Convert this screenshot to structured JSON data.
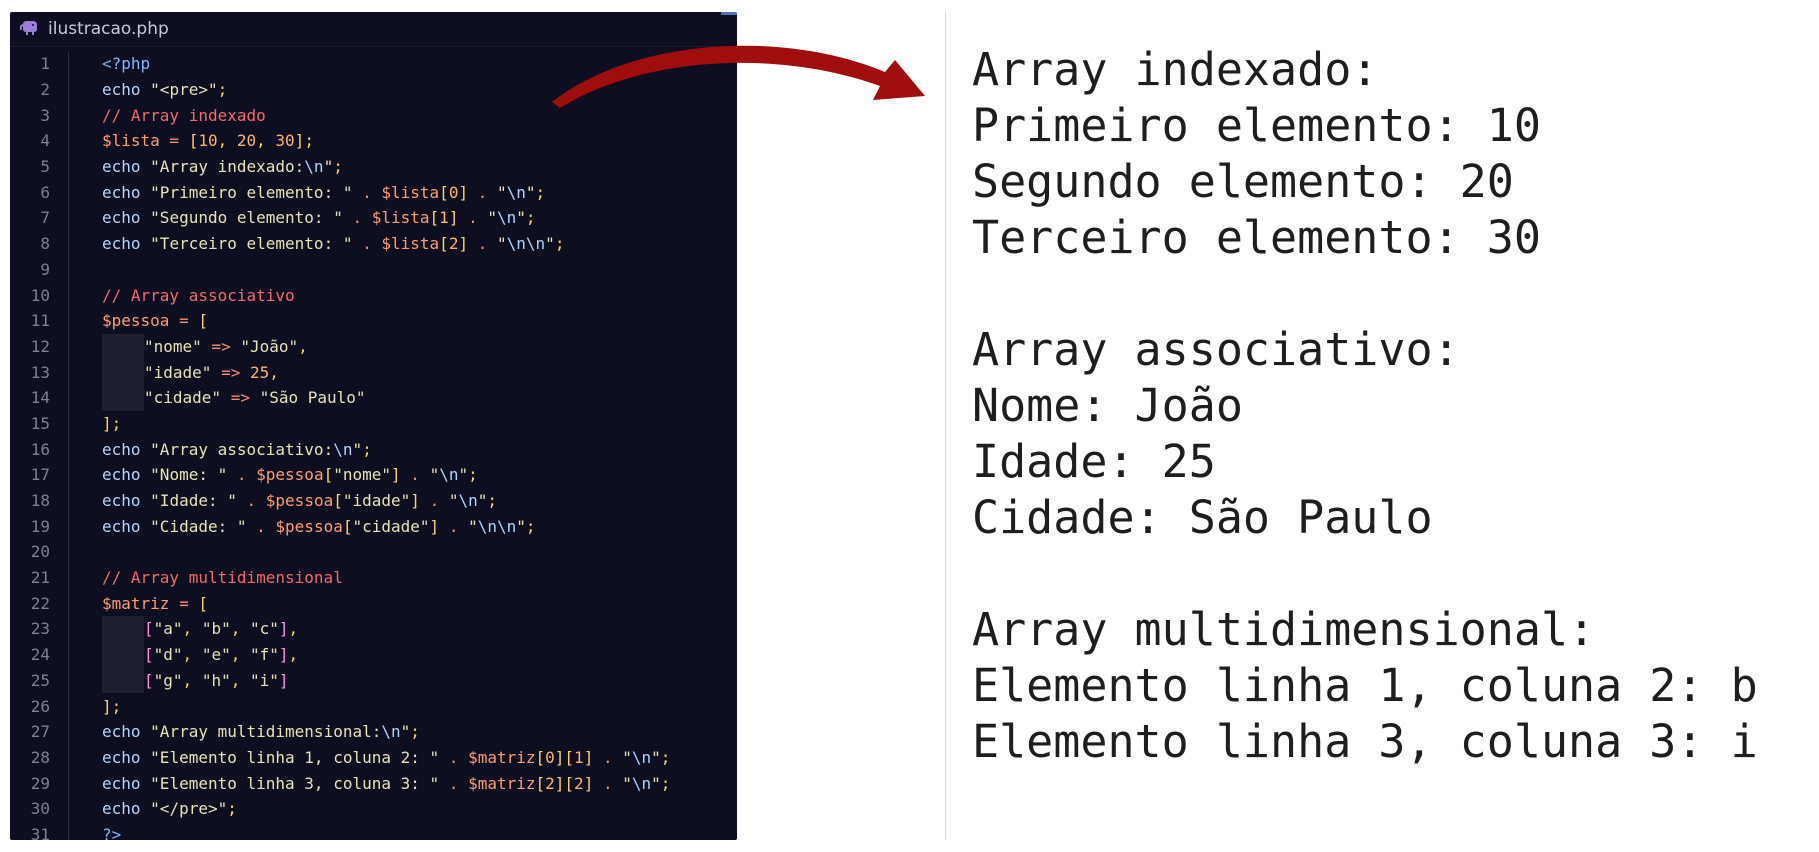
{
  "editor": {
    "filename": "ilustracao.php",
    "icon": "php-elephant-icon",
    "lines": [
      {
        "n": "1",
        "tokens": [
          [
            "kw",
            "<?php"
          ]
        ]
      },
      {
        "n": "2",
        "tokens": [
          [
            "fn",
            "echo "
          ],
          [
            "str",
            "\"<pre>\""
          ],
          [
            "punc",
            ";"
          ]
        ]
      },
      {
        "n": "3",
        "tokens": [
          [
            "com",
            "// Array indexado"
          ]
        ]
      },
      {
        "n": "4",
        "tokens": [
          [
            "var",
            "$lista"
          ],
          [
            "op",
            " = "
          ],
          [
            "punc",
            "["
          ],
          [
            "num",
            "10"
          ],
          [
            "punc",
            ", "
          ],
          [
            "num",
            "20"
          ],
          [
            "punc",
            ", "
          ],
          [
            "num",
            "30"
          ],
          [
            "punc",
            "]"
          ],
          [
            "punc",
            ";"
          ]
        ]
      },
      {
        "n": "5",
        "tokens": [
          [
            "fn",
            "echo "
          ],
          [
            "str",
            "\"Array indexado:"
          ],
          [
            "esc",
            "\\n"
          ],
          [
            "str",
            "\""
          ],
          [
            "punc",
            ";"
          ]
        ]
      },
      {
        "n": "6",
        "tokens": [
          [
            "fn",
            "echo "
          ],
          [
            "str",
            "\"Primeiro elemento: \""
          ],
          [
            "op",
            " . "
          ],
          [
            "var",
            "$lista"
          ],
          [
            "punc",
            "["
          ],
          [
            "num",
            "0"
          ],
          [
            "punc",
            "]"
          ],
          [
            "op",
            " . "
          ],
          [
            "str",
            "\""
          ],
          [
            "esc",
            "\\n"
          ],
          [
            "str",
            "\""
          ],
          [
            "punc",
            ";"
          ]
        ]
      },
      {
        "n": "7",
        "tokens": [
          [
            "fn",
            "echo "
          ],
          [
            "str",
            "\"Segundo elemento: \""
          ],
          [
            "op",
            " . "
          ],
          [
            "var",
            "$lista"
          ],
          [
            "punc",
            "["
          ],
          [
            "num",
            "1"
          ],
          [
            "punc",
            "]"
          ],
          [
            "op",
            " . "
          ],
          [
            "str",
            "\""
          ],
          [
            "esc",
            "\\n"
          ],
          [
            "str",
            "\""
          ],
          [
            "punc",
            ";"
          ]
        ]
      },
      {
        "n": "8",
        "tokens": [
          [
            "fn",
            "echo "
          ],
          [
            "str",
            "\"Terceiro elemento: \""
          ],
          [
            "op",
            " . "
          ],
          [
            "var",
            "$lista"
          ],
          [
            "punc",
            "["
          ],
          [
            "num",
            "2"
          ],
          [
            "punc",
            "]"
          ],
          [
            "op",
            " . "
          ],
          [
            "str",
            "\""
          ],
          [
            "esc",
            "\\n\\n"
          ],
          [
            "str",
            "\""
          ],
          [
            "punc",
            ";"
          ]
        ]
      },
      {
        "n": "9",
        "tokens": []
      },
      {
        "n": "10",
        "tokens": [
          [
            "com",
            "// Array associativo"
          ]
        ]
      },
      {
        "n": "11",
        "tokens": [
          [
            "var",
            "$pessoa"
          ],
          [
            "op",
            " = "
          ],
          [
            "punc",
            "["
          ]
        ]
      },
      {
        "n": "12",
        "indent": true,
        "tokens": [
          [
            "str",
            "\"nome\""
          ],
          [
            "op",
            " => "
          ],
          [
            "str",
            "\"João\""
          ],
          [
            "punc",
            ","
          ]
        ]
      },
      {
        "n": "13",
        "indent": true,
        "tokens": [
          [
            "str",
            "\"idade\""
          ],
          [
            "op",
            " => "
          ],
          [
            "num",
            "25"
          ],
          [
            "punc",
            ","
          ]
        ]
      },
      {
        "n": "14",
        "indent": true,
        "tokens": [
          [
            "str",
            "\"cidade\""
          ],
          [
            "op",
            " => "
          ],
          [
            "str",
            "\"São Paulo\""
          ]
        ]
      },
      {
        "n": "15",
        "tokens": [
          [
            "punc",
            "];"
          ]
        ]
      },
      {
        "n": "16",
        "tokens": [
          [
            "fn",
            "echo "
          ],
          [
            "str",
            "\"Array associativo:"
          ],
          [
            "esc",
            "\\n"
          ],
          [
            "str",
            "\""
          ],
          [
            "punc",
            ";"
          ]
        ]
      },
      {
        "n": "17",
        "tokens": [
          [
            "fn",
            "echo "
          ],
          [
            "str",
            "\"Nome: \""
          ],
          [
            "op",
            " . "
          ],
          [
            "var",
            "$pessoa"
          ],
          [
            "punc",
            "["
          ],
          [
            "str",
            "\"nome\""
          ],
          [
            "punc",
            "]"
          ],
          [
            "op",
            " . "
          ],
          [
            "str",
            "\""
          ],
          [
            "esc",
            "\\n"
          ],
          [
            "str",
            "\""
          ],
          [
            "punc",
            ";"
          ]
        ]
      },
      {
        "n": "18",
        "tokens": [
          [
            "fn",
            "echo "
          ],
          [
            "str",
            "\"Idade: \""
          ],
          [
            "op",
            " . "
          ],
          [
            "var",
            "$pessoa"
          ],
          [
            "punc",
            "["
          ],
          [
            "str",
            "\"idade\""
          ],
          [
            "punc",
            "]"
          ],
          [
            "op",
            " . "
          ],
          [
            "str",
            "\""
          ],
          [
            "esc",
            "\\n"
          ],
          [
            "str",
            "\""
          ],
          [
            "punc",
            ";"
          ]
        ]
      },
      {
        "n": "19",
        "tokens": [
          [
            "fn",
            "echo "
          ],
          [
            "str",
            "\"Cidade: \""
          ],
          [
            "op",
            " . "
          ],
          [
            "var",
            "$pessoa"
          ],
          [
            "punc",
            "["
          ],
          [
            "str",
            "\"cidade\""
          ],
          [
            "punc",
            "]"
          ],
          [
            "op",
            " . "
          ],
          [
            "str",
            "\""
          ],
          [
            "esc",
            "\\n\\n"
          ],
          [
            "str",
            "\""
          ],
          [
            "punc",
            ";"
          ]
        ]
      },
      {
        "n": "20",
        "tokens": []
      },
      {
        "n": "21",
        "tokens": [
          [
            "com",
            "// Array multidimensional"
          ]
        ]
      },
      {
        "n": "22",
        "tokens": [
          [
            "var",
            "$matriz"
          ],
          [
            "op",
            " = "
          ],
          [
            "punc",
            "["
          ]
        ]
      },
      {
        "n": "23",
        "indent": true,
        "tokens": [
          [
            "arr",
            "["
          ],
          [
            "str",
            "\"a\""
          ],
          [
            "punc",
            ", "
          ],
          [
            "str",
            "\"b\""
          ],
          [
            "punc",
            ", "
          ],
          [
            "str",
            "\"c\""
          ],
          [
            "arr",
            "]"
          ],
          [
            "punc",
            ","
          ]
        ]
      },
      {
        "n": "24",
        "indent": true,
        "tokens": [
          [
            "arr",
            "["
          ],
          [
            "str",
            "\"d\""
          ],
          [
            "punc",
            ", "
          ],
          [
            "str",
            "\"e\""
          ],
          [
            "punc",
            ", "
          ],
          [
            "str",
            "\"f\""
          ],
          [
            "arr",
            "]"
          ],
          [
            "punc",
            ","
          ]
        ]
      },
      {
        "n": "25",
        "indent": true,
        "tokens": [
          [
            "arr",
            "["
          ],
          [
            "str",
            "\"g\""
          ],
          [
            "punc",
            ", "
          ],
          [
            "str",
            "\"h\""
          ],
          [
            "punc",
            ", "
          ],
          [
            "str",
            "\"i\""
          ],
          [
            "arr",
            "]"
          ]
        ]
      },
      {
        "n": "26",
        "tokens": [
          [
            "punc",
            "];"
          ]
        ]
      },
      {
        "n": "27",
        "tokens": [
          [
            "fn",
            "echo "
          ],
          [
            "str",
            "\"Array multidimensional:"
          ],
          [
            "esc",
            "\\n"
          ],
          [
            "str",
            "\""
          ],
          [
            "punc",
            ";"
          ]
        ]
      },
      {
        "n": "28",
        "tokens": [
          [
            "fn",
            "echo "
          ],
          [
            "str",
            "\"Elemento linha 1, coluna 2: \""
          ],
          [
            "op",
            " . "
          ],
          [
            "var",
            "$matriz"
          ],
          [
            "punc",
            "["
          ],
          [
            "num",
            "0"
          ],
          [
            "punc",
            "]["
          ],
          [
            "num",
            "1"
          ],
          [
            "punc",
            "]"
          ],
          [
            "op",
            " . "
          ],
          [
            "str",
            "\""
          ],
          [
            "esc",
            "\\n"
          ],
          [
            "str",
            "\""
          ],
          [
            "punc",
            ";"
          ]
        ]
      },
      {
        "n": "29",
        "tokens": [
          [
            "fn",
            "echo "
          ],
          [
            "str",
            "\"Elemento linha 3, coluna 3: \""
          ],
          [
            "op",
            " . "
          ],
          [
            "var",
            "$matriz"
          ],
          [
            "punc",
            "["
          ],
          [
            "num",
            "2"
          ],
          [
            "punc",
            "]["
          ],
          [
            "num",
            "2"
          ],
          [
            "punc",
            "]"
          ],
          [
            "op",
            " . "
          ],
          [
            "str",
            "\""
          ],
          [
            "esc",
            "\\n"
          ],
          [
            "str",
            "\""
          ],
          [
            "punc",
            ";"
          ]
        ]
      },
      {
        "n": "30",
        "tokens": [
          [
            "fn",
            "echo "
          ],
          [
            "str",
            "\"</pre>\""
          ],
          [
            "punc",
            ";"
          ]
        ]
      },
      {
        "n": "31",
        "tokens": [
          [
            "kw",
            "?>"
          ]
        ]
      }
    ]
  },
  "arrow": {
    "icon": "curved-arrow-icon",
    "color": "#a00d0d"
  },
  "output": {
    "lines": [
      "Array indexado:",
      "Primeiro elemento: 10",
      "Segundo elemento: 20",
      "Terceiro elemento: 30",
      "",
      "Array associativo:",
      "Nome: João",
      "Idade: 25",
      "Cidade: São Paulo",
      "",
      "Array multidimensional:",
      "Elemento linha 1, coluna 2: b",
      "Elemento linha 3, coluna 3: i"
    ]
  }
}
